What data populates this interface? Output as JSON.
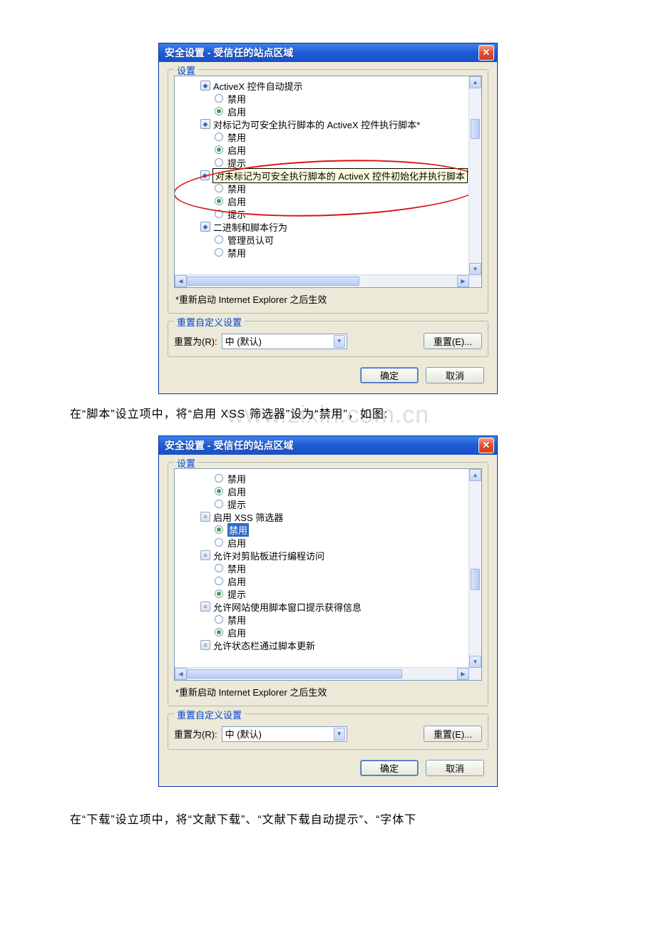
{
  "dialog1": {
    "title": "安全设置 - 受信任的站点区域",
    "settings_label": "设置",
    "items": {
      "activex_auto_prompt": "ActiveX 控件自动提示",
      "disable": "禁用",
      "enable": "启用",
      "prompt": "提示",
      "safe_script_activex": "对标记为可安全执行脚本的 ActiveX 控件执行脚本*",
      "unsafe_init_tooltip": "对未标记为可安全执行脚本的 ActiveX 控件初始化并执行脚本",
      "binary_script_behavior": "二进制和脚本行为",
      "admin_approved": "管理员认可"
    },
    "note": "*重新启动 Internet Explorer 之后生效",
    "reset_group_label": "重置自定义设置",
    "reset_label": "重置为(R):",
    "reset_value": "中 (默认)",
    "reset_btn": "重置(E)...",
    "ok": "确定",
    "cancel": "取消"
  },
  "text1": "在“脚本”设立项中，将“启用 XSS 筛选器”设为“禁用”，如图:",
  "watermark": "www.zixin.com.cn",
  "dialog2": {
    "title": "安全设置 - 受信任的站点区域",
    "settings_label": "设置",
    "items": {
      "disable": "禁用",
      "enable": "启用",
      "prompt": "提示",
      "xss_filter": "启用 XSS 筛选器",
      "clipboard_access": "允许对剪贴板进行编程访问",
      "script_window_prompt": "允许网站使用脚本窗口提示获得信息",
      "statusbar_script": "允许状态栏通过脚本更新"
    },
    "note": "*重新启动 Internet Explorer 之后生效",
    "reset_group_label": "重置自定义设置",
    "reset_label": "重置为(R):",
    "reset_value": "中 (默认)",
    "reset_btn": "重置(E)...",
    "ok": "确定",
    "cancel": "取消"
  },
  "text2": "在“下载”设立项中，将“文献下载”、“文献下载自动提示”、“字体下"
}
